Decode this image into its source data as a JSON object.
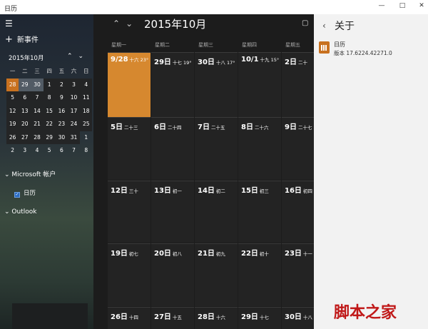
{
  "window": {
    "title": "日历",
    "buttons": [
      "—",
      "□",
      "✕"
    ]
  },
  "sidebar": {
    "new_event": "新事件",
    "mini_month_title": "2015年10月",
    "weekday_headers": [
      "一",
      "二",
      "三",
      "四",
      "五",
      "六",
      "日"
    ],
    "weeks": [
      [
        "28",
        "29",
        "30",
        "1",
        "2",
        "3",
        "4"
      ],
      [
        "5",
        "6",
        "7",
        "8",
        "9",
        "10",
        "11"
      ],
      [
        "12",
        "13",
        "14",
        "15",
        "16",
        "17",
        "18"
      ],
      [
        "19",
        "20",
        "21",
        "22",
        "23",
        "24",
        "25"
      ],
      [
        "26",
        "27",
        "28",
        "29",
        "30",
        "31",
        "1"
      ],
      [
        "2",
        "3",
        "4",
        "5",
        "6",
        "7",
        "8"
      ]
    ],
    "microsoft_account": "Microsoft 帐户",
    "calendar_item": "日历",
    "outlook": "Outlook"
  },
  "main": {
    "month_title": "2015年10月",
    "weekdays": [
      "星期一",
      "星期二",
      "星期三",
      "星期四",
      "星期五"
    ],
    "rows": [
      [
        {
          "d": "9/28",
          "l": "十六 23°"
        },
        {
          "d": "29日",
          "l": "十七 19°"
        },
        {
          "d": "30日",
          "l": "十八 17°"
        },
        {
          "d": "10/1",
          "l": "十九 15°"
        },
        {
          "d": "2日",
          "l": "二十"
        }
      ],
      [
        {
          "d": "5日",
          "l": "二十三"
        },
        {
          "d": "6日",
          "l": "二十四"
        },
        {
          "d": "7日",
          "l": "二十五"
        },
        {
          "d": "8日",
          "l": "二十六"
        },
        {
          "d": "9日",
          "l": "二十七"
        }
      ],
      [
        {
          "d": "12日",
          "l": "三十"
        },
        {
          "d": "13日",
          "l": "初一"
        },
        {
          "d": "14日",
          "l": "初二"
        },
        {
          "d": "15日",
          "l": "初三"
        },
        {
          "d": "16日",
          "l": "初四"
        }
      ],
      [
        {
          "d": "19日",
          "l": "初七"
        },
        {
          "d": "20日",
          "l": "初八"
        },
        {
          "d": "21日",
          "l": "初九"
        },
        {
          "d": "22日",
          "l": "初十"
        },
        {
          "d": "23日",
          "l": "十一"
        }
      ],
      [
        {
          "d": "26日",
          "l": "十四"
        },
        {
          "d": "27日",
          "l": "十五"
        },
        {
          "d": "28日",
          "l": "十六"
        },
        {
          "d": "29日",
          "l": "十七"
        },
        {
          "d": "30日",
          "l": "十八"
        }
      ]
    ]
  },
  "about": {
    "title": "关于",
    "app_name": "日历",
    "version": "版本 17.6224.42271.0"
  },
  "watermark": "脚本之家",
  "colors": {
    "accent": "#d6882f",
    "panel_bg": "#f2f2f2",
    "main_bg": "#1c1c1c"
  }
}
